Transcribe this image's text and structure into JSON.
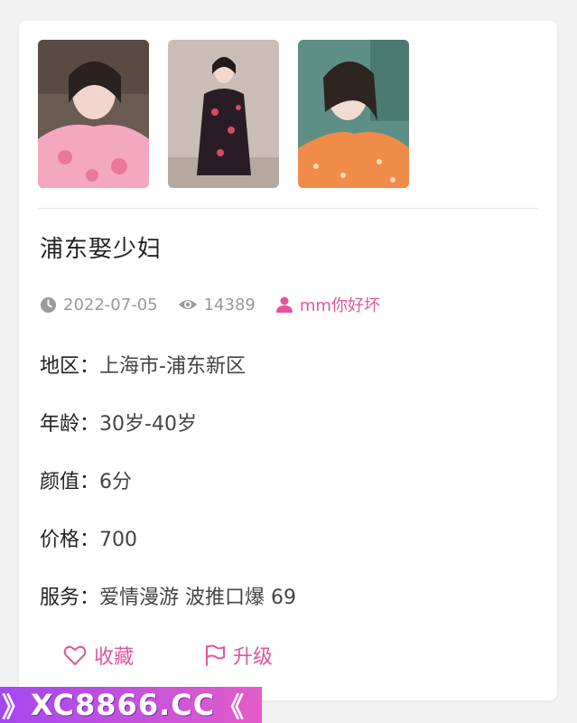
{
  "photos": [
    {
      "alt": "photo-1"
    },
    {
      "alt": "photo-2"
    },
    {
      "alt": "photo-3"
    }
  ],
  "post": {
    "title": "浦东娶少妇",
    "date": "2022-07-05",
    "views": "14389",
    "author": "mm你好坏"
  },
  "details": {
    "region_label": "地区：",
    "region_value": "上海市-浦东新区",
    "age_label": "年龄：",
    "age_value": "30岁-40岁",
    "looks_label": "颜值：",
    "looks_value": "6分",
    "price_label": "价格：",
    "price_value": "700",
    "service_label": "服务：",
    "service_value": "爱情漫游 波推口爆 69"
  },
  "actions": {
    "favorite": "收藏",
    "upgrade": "升级"
  },
  "watermark": {
    "text": "XC8866.CC",
    "left": "》",
    "right": "《"
  },
  "colors": {
    "accent": "#e0569b",
    "meta": "#999999"
  }
}
